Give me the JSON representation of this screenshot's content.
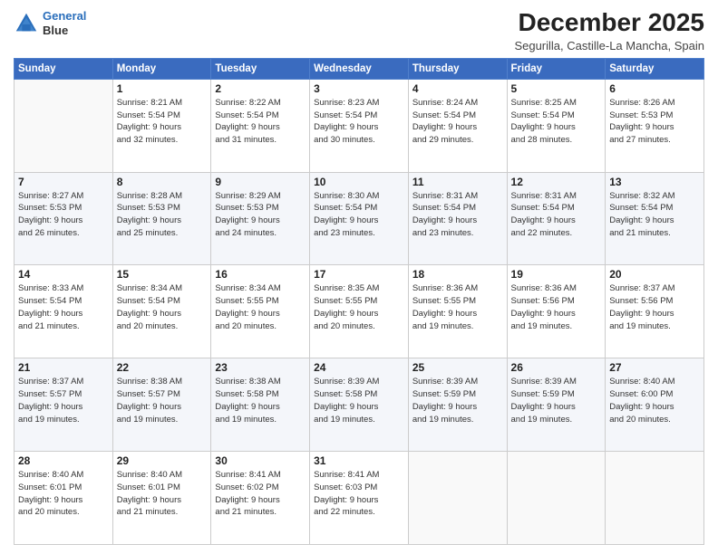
{
  "header": {
    "logo_line1": "General",
    "logo_line2": "Blue",
    "title": "December 2025",
    "subtitle": "Segurilla, Castille-La Mancha, Spain"
  },
  "weekdays": [
    "Sunday",
    "Monday",
    "Tuesday",
    "Wednesday",
    "Thursday",
    "Friday",
    "Saturday"
  ],
  "weeks": [
    [
      {
        "day": "",
        "info": ""
      },
      {
        "day": "1",
        "info": "Sunrise: 8:21 AM\nSunset: 5:54 PM\nDaylight: 9 hours\nand 32 minutes."
      },
      {
        "day": "2",
        "info": "Sunrise: 8:22 AM\nSunset: 5:54 PM\nDaylight: 9 hours\nand 31 minutes."
      },
      {
        "day": "3",
        "info": "Sunrise: 8:23 AM\nSunset: 5:54 PM\nDaylight: 9 hours\nand 30 minutes."
      },
      {
        "day": "4",
        "info": "Sunrise: 8:24 AM\nSunset: 5:54 PM\nDaylight: 9 hours\nand 29 minutes."
      },
      {
        "day": "5",
        "info": "Sunrise: 8:25 AM\nSunset: 5:54 PM\nDaylight: 9 hours\nand 28 minutes."
      },
      {
        "day": "6",
        "info": "Sunrise: 8:26 AM\nSunset: 5:53 PM\nDaylight: 9 hours\nand 27 minutes."
      }
    ],
    [
      {
        "day": "7",
        "info": "Sunrise: 8:27 AM\nSunset: 5:53 PM\nDaylight: 9 hours\nand 26 minutes."
      },
      {
        "day": "8",
        "info": "Sunrise: 8:28 AM\nSunset: 5:53 PM\nDaylight: 9 hours\nand 25 minutes."
      },
      {
        "day": "9",
        "info": "Sunrise: 8:29 AM\nSunset: 5:53 PM\nDaylight: 9 hours\nand 24 minutes."
      },
      {
        "day": "10",
        "info": "Sunrise: 8:30 AM\nSunset: 5:54 PM\nDaylight: 9 hours\nand 23 minutes."
      },
      {
        "day": "11",
        "info": "Sunrise: 8:31 AM\nSunset: 5:54 PM\nDaylight: 9 hours\nand 23 minutes."
      },
      {
        "day": "12",
        "info": "Sunrise: 8:31 AM\nSunset: 5:54 PM\nDaylight: 9 hours\nand 22 minutes."
      },
      {
        "day": "13",
        "info": "Sunrise: 8:32 AM\nSunset: 5:54 PM\nDaylight: 9 hours\nand 21 minutes."
      }
    ],
    [
      {
        "day": "14",
        "info": "Sunrise: 8:33 AM\nSunset: 5:54 PM\nDaylight: 9 hours\nand 21 minutes."
      },
      {
        "day": "15",
        "info": "Sunrise: 8:34 AM\nSunset: 5:54 PM\nDaylight: 9 hours\nand 20 minutes."
      },
      {
        "day": "16",
        "info": "Sunrise: 8:34 AM\nSunset: 5:55 PM\nDaylight: 9 hours\nand 20 minutes."
      },
      {
        "day": "17",
        "info": "Sunrise: 8:35 AM\nSunset: 5:55 PM\nDaylight: 9 hours\nand 20 minutes."
      },
      {
        "day": "18",
        "info": "Sunrise: 8:36 AM\nSunset: 5:55 PM\nDaylight: 9 hours\nand 19 minutes."
      },
      {
        "day": "19",
        "info": "Sunrise: 8:36 AM\nSunset: 5:56 PM\nDaylight: 9 hours\nand 19 minutes."
      },
      {
        "day": "20",
        "info": "Sunrise: 8:37 AM\nSunset: 5:56 PM\nDaylight: 9 hours\nand 19 minutes."
      }
    ],
    [
      {
        "day": "21",
        "info": "Sunrise: 8:37 AM\nSunset: 5:57 PM\nDaylight: 9 hours\nand 19 minutes."
      },
      {
        "day": "22",
        "info": "Sunrise: 8:38 AM\nSunset: 5:57 PM\nDaylight: 9 hours\nand 19 minutes."
      },
      {
        "day": "23",
        "info": "Sunrise: 8:38 AM\nSunset: 5:58 PM\nDaylight: 9 hours\nand 19 minutes."
      },
      {
        "day": "24",
        "info": "Sunrise: 8:39 AM\nSunset: 5:58 PM\nDaylight: 9 hours\nand 19 minutes."
      },
      {
        "day": "25",
        "info": "Sunrise: 8:39 AM\nSunset: 5:59 PM\nDaylight: 9 hours\nand 19 minutes."
      },
      {
        "day": "26",
        "info": "Sunrise: 8:39 AM\nSunset: 5:59 PM\nDaylight: 9 hours\nand 19 minutes."
      },
      {
        "day": "27",
        "info": "Sunrise: 8:40 AM\nSunset: 6:00 PM\nDaylight: 9 hours\nand 20 minutes."
      }
    ],
    [
      {
        "day": "28",
        "info": "Sunrise: 8:40 AM\nSunset: 6:01 PM\nDaylight: 9 hours\nand 20 minutes."
      },
      {
        "day": "29",
        "info": "Sunrise: 8:40 AM\nSunset: 6:01 PM\nDaylight: 9 hours\nand 21 minutes."
      },
      {
        "day": "30",
        "info": "Sunrise: 8:41 AM\nSunset: 6:02 PM\nDaylight: 9 hours\nand 21 minutes."
      },
      {
        "day": "31",
        "info": "Sunrise: 8:41 AM\nSunset: 6:03 PM\nDaylight: 9 hours\nand 22 minutes."
      },
      {
        "day": "",
        "info": ""
      },
      {
        "day": "",
        "info": ""
      },
      {
        "day": "",
        "info": ""
      }
    ]
  ]
}
